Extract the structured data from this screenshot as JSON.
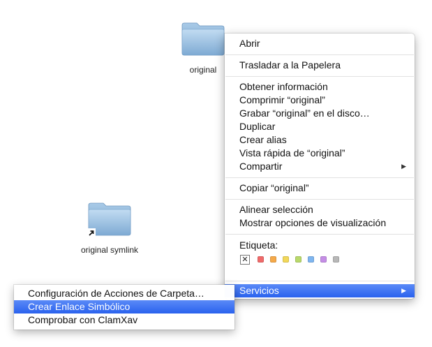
{
  "desktop": {
    "icons": [
      {
        "label": "original"
      },
      {
        "label": "original symlink"
      }
    ]
  },
  "context_menu": {
    "items": {
      "open": "Abrir",
      "trash": "Trasladar a la Papelera",
      "get_info": "Obtener información",
      "compress": "Comprimir “original”",
      "burn": "Grabar “original” en el disco…",
      "duplicate": "Duplicar",
      "make_alias": "Crear alias",
      "quick_look": "Vista rápida de “original”",
      "share": "Compartir",
      "copy": "Copiar “original”",
      "align": "Alinear selección",
      "view_options": "Mostrar opciones de visualización",
      "label_heading": "Etiqueta:",
      "services": "Servicios"
    },
    "submenu_arrow": "▶",
    "label_none_mark": "✕",
    "label_colors": [
      "#f06a6a",
      "#f5a94a",
      "#f2d85a",
      "#b9d96b",
      "#7fb6f0",
      "#c58ee6",
      "#b8b8b8"
    ]
  },
  "services_menu": {
    "items": [
      {
        "label": "Configuración de Acciones de Carpeta…",
        "highlighted": false
      },
      {
        "label": "Crear Enlace Simbólico",
        "highlighted": true
      },
      {
        "label": "Comprobar con ClamXav",
        "highlighted": false
      }
    ]
  },
  "colors": {
    "highlight": "#3a6ff0",
    "folder_body": "#8fb4d8"
  }
}
